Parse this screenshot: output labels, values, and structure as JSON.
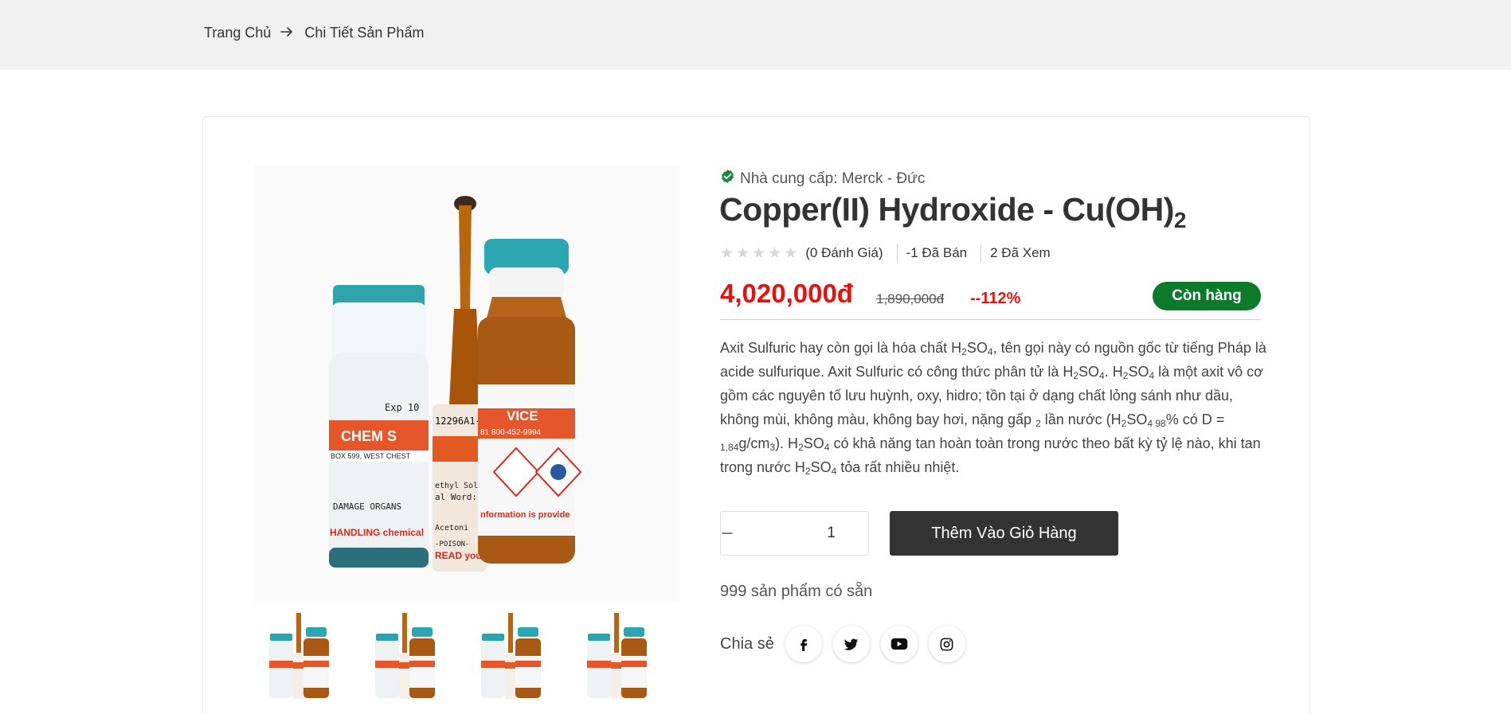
{
  "breadcrumb": {
    "home": "Trang Chủ",
    "current": "Chi Tiết Sản Phẩm"
  },
  "product": {
    "supplier": "Nhà cung cấp: Merck - Đức",
    "title_main": "Copper(II) Hydroxide - Cu(OH)",
    "title_sub": "2",
    "rating_stars": 0,
    "reviews": "(0 Đánh Giá)",
    "sold": "-1 Đã Bán",
    "views": "2 Đã Xem",
    "price": "4,020,000đ",
    "old_price": "1,890,000đ",
    "discount": "--112%",
    "stock_status": "Còn hàng",
    "quantity": "1",
    "add_to_cart": "Thêm Vào Giỏ Hàng",
    "available": "999 sản phẩm có sẵn",
    "share_label": "Chia sẻ"
  },
  "description": {
    "t1": "Axit Sulfuric hay còn gọi là hóa chất H",
    "s1": "2",
    "t2": "SO",
    "s2": "4",
    "t3": ", tên gọi này có nguồn gốc từ tiếng Pháp là acide sulfurique. Axit Sulfuric có công thức phân tử là H",
    "s3": "2",
    "t4": "SO",
    "s4": "4",
    "t5": ". H",
    "s5": "2",
    "t6": "SO",
    "s6": "4",
    "t7": " là một axit vô cơ gồm các nguyên tố lưu huỳnh, oxy, hidro; tồn tại ở dạng chất lỏng sánh như dầu, không mùi, không màu, không bay hơi, nặng gấp ",
    "s7": "2",
    "t8": " lần nước (H",
    "s8": "2",
    "t9": "SO",
    "s9": "4 98",
    "t10": "% có D = ",
    "s10": "1,84",
    "t11": "g/cm",
    "s11": "3",
    "t12": "). H",
    "s12": "2",
    "t13": "SO",
    "s13": "4",
    "t14": " có khả năng tan hoàn toàn trong nước theo bất kỳ tỷ lệ nào, khi tan trong nước H",
    "s14": "2",
    "t15": "SO",
    "s15": "4",
    "t16": " tỏa rất nhiều nhiệt."
  },
  "image_labels": {
    "exp": "Exp 10",
    "chem": "CHEM S",
    "address": "BOX 599, WEST CHEST",
    "damage": "DAMAGE ORGANS",
    "handling": "HANDLING chemical",
    "ampoule_code": "12296A1-1",
    "methyl": "ethyl Solu",
    "signal": "al Word:",
    "acetonitrile": "Acetoni",
    "poison": "-POISON-",
    "read": "READ you",
    "vice": "VICE",
    "phone": "81 800-452-9994",
    "info": "nformation is provide"
  },
  "icons": {
    "supplier": "verified-check-icon",
    "social": [
      "facebook-icon",
      "twitter-icon",
      "youtube-icon",
      "instagram-icon"
    ]
  },
  "colors": {
    "price": "#e4130e",
    "stock_badge": "#0b7a2a",
    "button": "#333333"
  }
}
